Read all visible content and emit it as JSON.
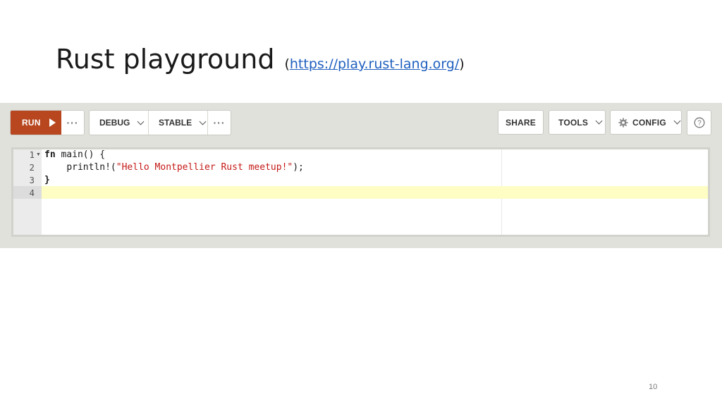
{
  "slide": {
    "title": "Rust playground",
    "paren_open": "(",
    "link": "https://play.rust-lang.org/",
    "paren_close": ")",
    "page_number": "10"
  },
  "toolbar": {
    "run_label": "RUN",
    "more_label": "···",
    "debug_label": "DEBUG",
    "stable_label": "STABLE",
    "share_label": "SHARE",
    "tools_label": "TOOLS",
    "config_label": "CONFIG",
    "help_icon": "question-circle-icon",
    "run_color": "#b8461f"
  },
  "editor": {
    "line_numbers": [
      "1",
      "2",
      "3",
      "4"
    ],
    "lines": [
      {
        "kw": "fn",
        "rest": " main() {"
      },
      {
        "indent": "    ",
        "macro": "println!(",
        "string": "\"Hello Montpellier Rust meetup!\"",
        "tail": ");"
      },
      {
        "text": "}"
      },
      {
        "text": ""
      }
    ],
    "active_line": 4,
    "active_line_color": "#fdfdc4"
  }
}
